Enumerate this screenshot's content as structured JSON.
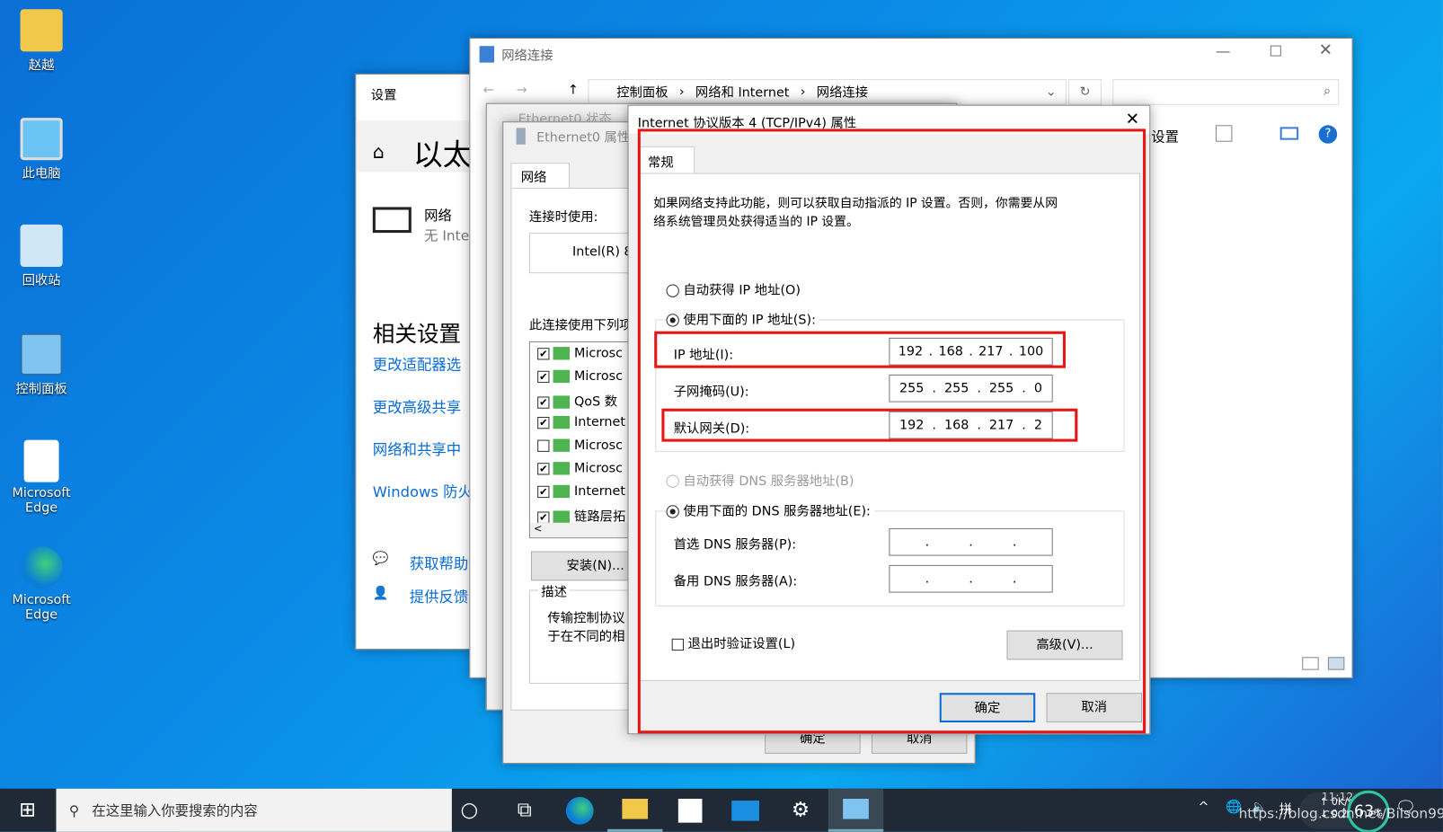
{
  "desktop": {
    "icons": [
      {
        "label": "赵越",
        "icon": "user-folder-icon"
      },
      {
        "label": "此电脑",
        "icon": "computer-icon"
      },
      {
        "label": "回收站",
        "icon": "recycle-bin-icon"
      },
      {
        "label": "控制面板",
        "icon": "control-panel-icon"
      },
      {
        "label": "Microsoft Edge",
        "icon": "file-shortcut-icon"
      },
      {
        "label": "Microsoft Edge",
        "icon": "edge-icon"
      }
    ]
  },
  "settings": {
    "title": "设置",
    "heading": "以太",
    "network_name": "网络",
    "network_status": "无 Inte",
    "related": "相关设置",
    "links": [
      "更改适配器选",
      "更改高级共享",
      "网络和共享中",
      "Windows 防火"
    ],
    "help": "获取帮助",
    "feedback": "提供反馈"
  },
  "explorer": {
    "title": "网络连接",
    "breadcrumb": [
      "控制面板",
      "网络和 Internet",
      "网络连接"
    ],
    "toolbar_text": "设置"
  },
  "eth_status": {
    "title": "Ethernet0 状态"
  },
  "eth_props": {
    "title": "Ethernet0 属性",
    "tab": "网络",
    "connect_using": "连接时使用:",
    "adapter": "Intel(R) 8",
    "items_label": "此连接使用下列项",
    "items": [
      {
        "checked": true,
        "label": "Microsc"
      },
      {
        "checked": true,
        "label": "Microsc"
      },
      {
        "checked": true,
        "label": "QoS 数"
      },
      {
        "checked": true,
        "label": "Internet"
      },
      {
        "checked": false,
        "label": "Microsc"
      },
      {
        "checked": true,
        "label": "Microsc"
      },
      {
        "checked": true,
        "label": "Internet"
      },
      {
        "checked": true,
        "label": "链路层拓"
      }
    ],
    "install": "安装(N)...",
    "desc_label": "描述",
    "desc": [
      "传输控制协议",
      "于在不同的相"
    ],
    "ok": "确定",
    "cancel": "取消"
  },
  "ipv4": {
    "title": "Internet 协议版本 4 (TCP/IPv4) 属性",
    "tab": "常规",
    "intro": [
      "如果网络支持此功能，则可以获取自动指派的 IP 设置。否则，你需要从网",
      "络系统管理员处获得适当的 IP 设置。"
    ],
    "auto_ip": "自动获得 IP 地址(O)",
    "manual_ip": "使用下面的 IP 地址(S):",
    "ip_label": "IP 地址(I):",
    "ip": [
      "192",
      "168",
      "217",
      "100"
    ],
    "mask_label": "子网掩码(U):",
    "mask": [
      "255",
      "255",
      "255",
      "0"
    ],
    "gw_label": "默认网关(D):",
    "gw": [
      "192",
      "168",
      "217",
      "2"
    ],
    "auto_dns": "自动获得 DNS 服务器地址(B)",
    "manual_dns": "使用下面的 DNS 服务器地址(E):",
    "dns1_label": "首选 DNS 服务器(P):",
    "dns2_label": "备用 DNS 服务器(A):",
    "validate": "退出时验证设置(L)",
    "advanced": "高级(V)...",
    "ok": "确定",
    "cancel": "取消",
    "ip_mode": "manual",
    "dns_mode": "manual",
    "validate_checked": false
  },
  "taskbar": {
    "search_placeholder": "在这里输入你要搜索的内容",
    "time": "11:12",
    "net_up": "0",
    "net_down": "0.2",
    "net_unit": "K/s",
    "cpu": "63",
    "cpu_unit": "%",
    "watermark": "https://blog.csdn.net/Bilson99"
  },
  "colors": {
    "highlight": "#e81515",
    "accent": "#0a6cd6",
    "taskbar": "#1f2a36"
  }
}
